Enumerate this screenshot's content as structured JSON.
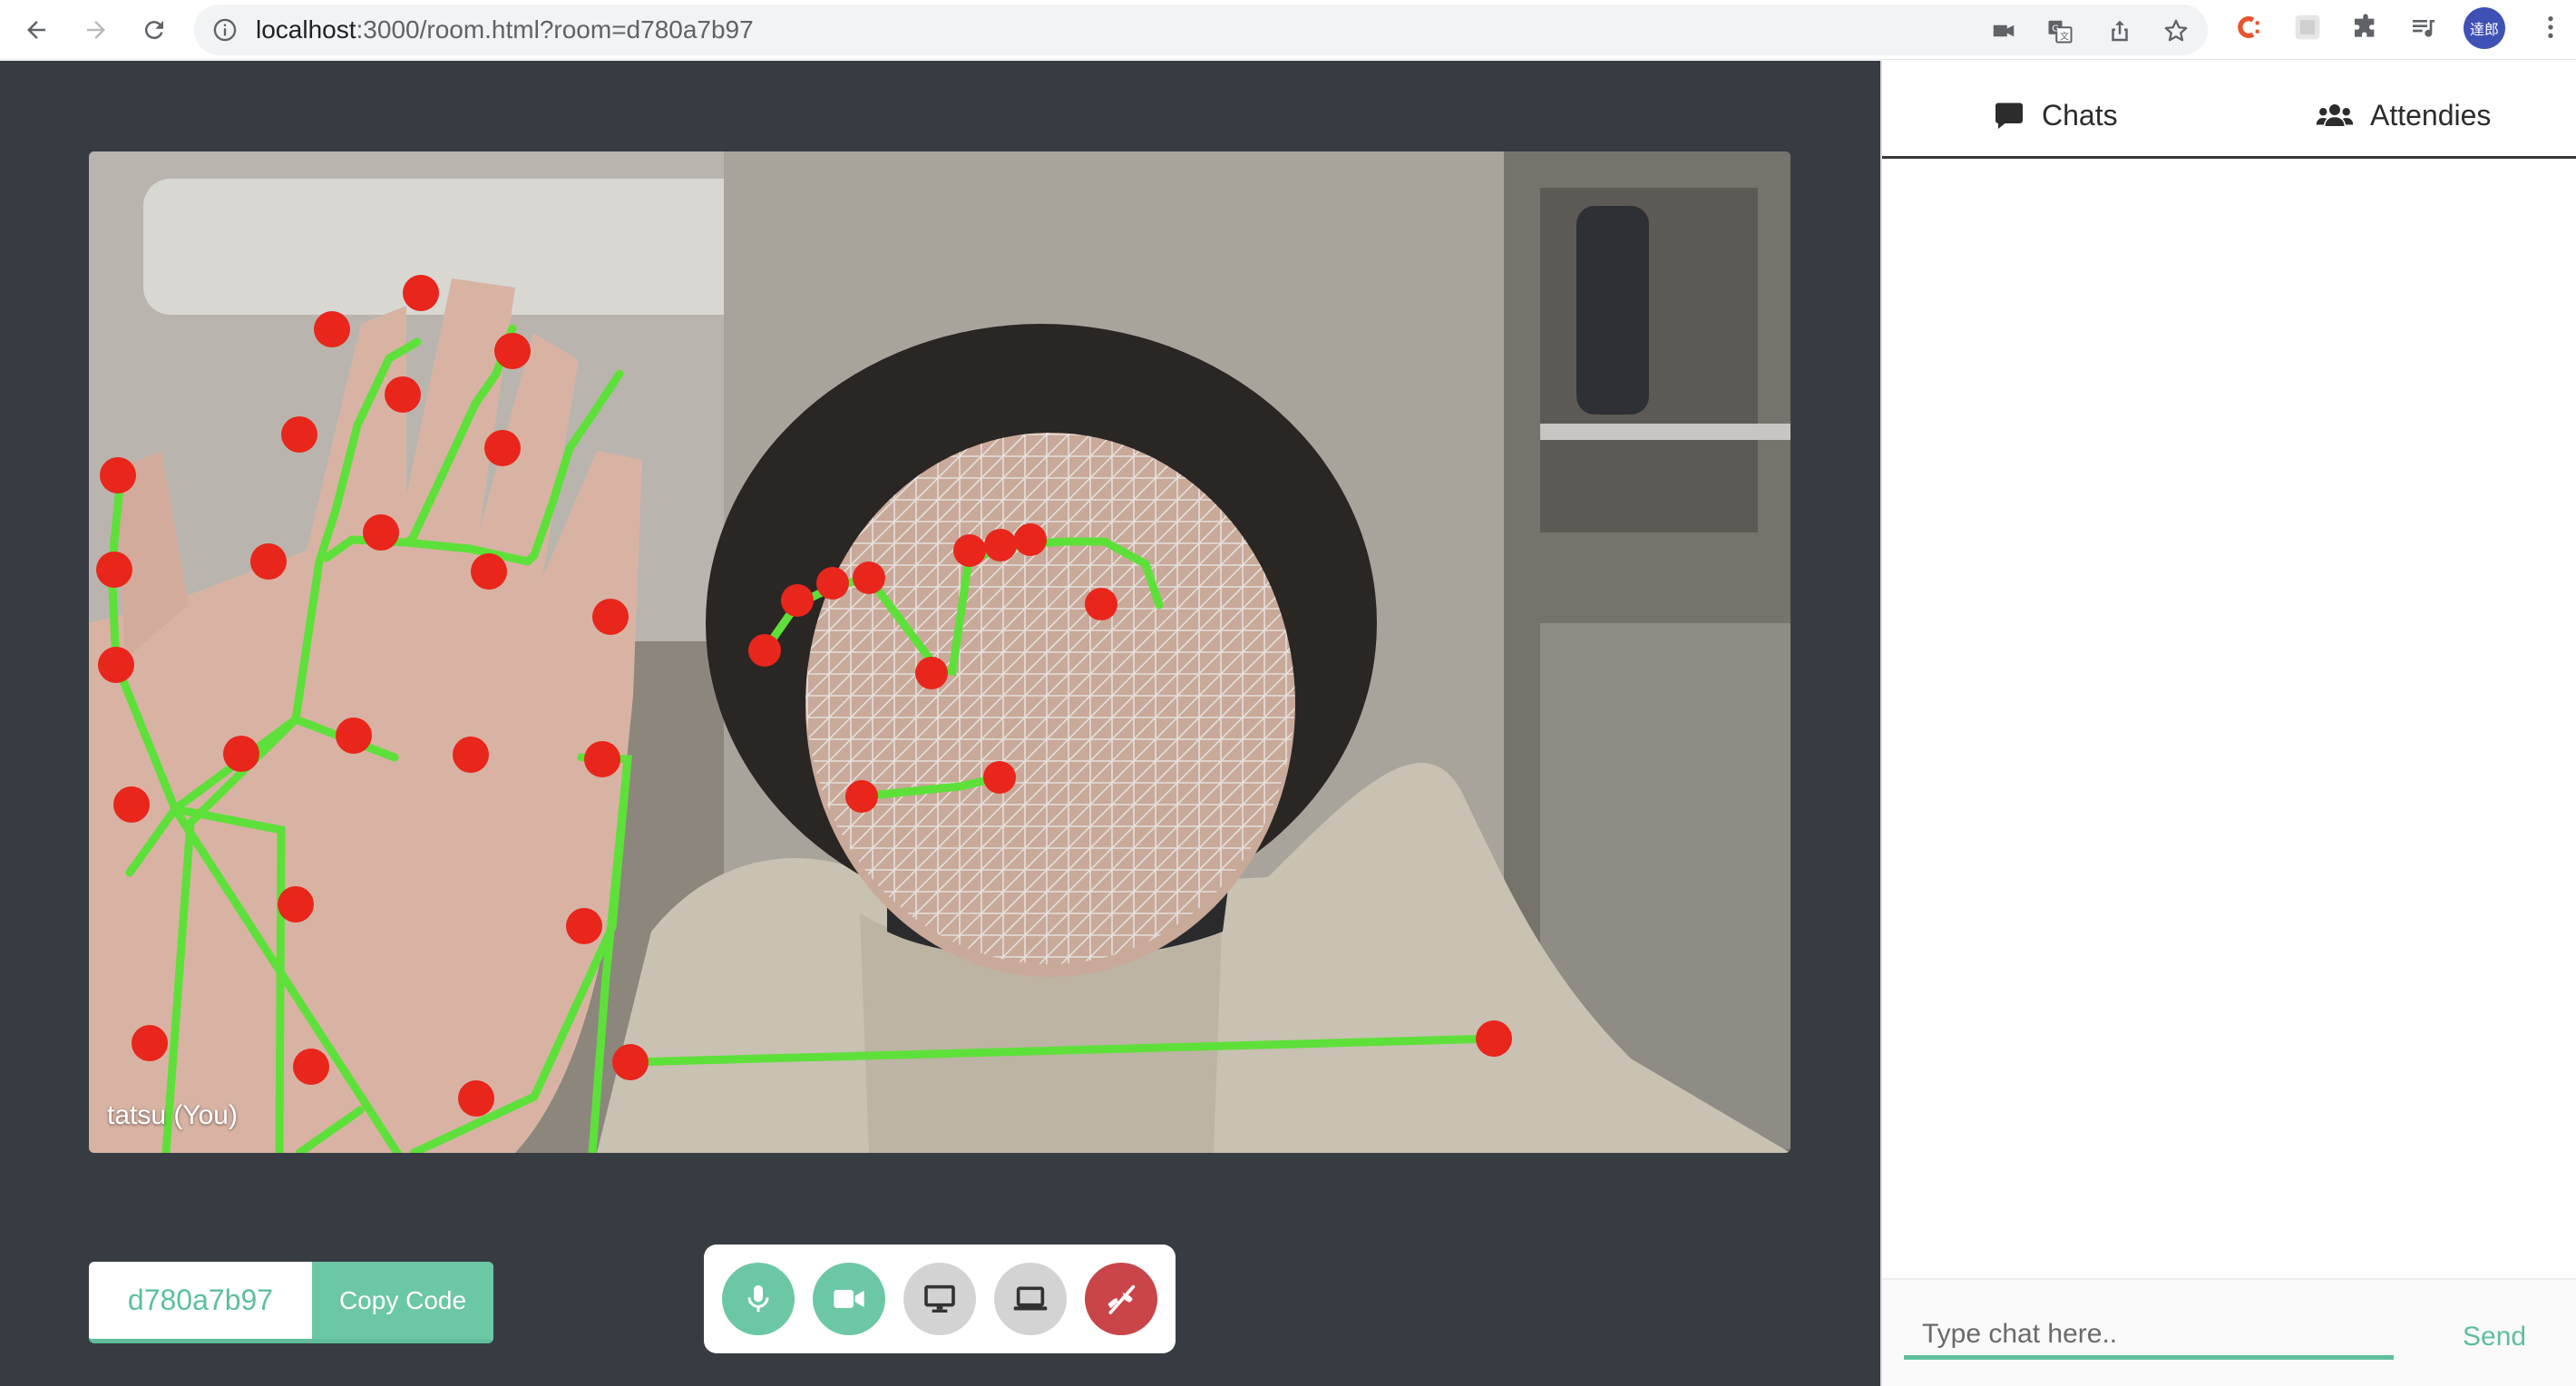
{
  "browser": {
    "url_host": "localhost",
    "url_path": ":3000/room.html?room=d780a7b97",
    "avatar_text": "達郎",
    "icons": [
      "back-icon",
      "forward-icon",
      "reload-icon",
      "info-icon",
      "camera-icon",
      "translate-icon",
      "share-icon",
      "star-icon",
      "extension-c-icon",
      "extension-grid-icon",
      "puzzle-icon",
      "playlist-icon",
      "more-vert-icon"
    ]
  },
  "video": {
    "participant_name": "tatsu (You)"
  },
  "room": {
    "code": "d780a7b97",
    "copy_label": "Copy Code"
  },
  "controls": {
    "buttons": [
      "mic-button",
      "camera-button",
      "screen-share-button",
      "laptop-button",
      "end-call-button"
    ],
    "colors": {
      "active": "#6cc7a5",
      "inactive": "#d3d3d3",
      "end": "#c9454a"
    }
  },
  "side_panel": {
    "tabs": [
      {
        "label": "Chats",
        "icon": "chat-bubble-icon"
      },
      {
        "label": "Attendies",
        "icon": "users-icon"
      }
    ],
    "chat_placeholder": "Type chat here..",
    "send_label": "Send"
  },
  "colors": {
    "accent": "#5fbf9b",
    "background": "#373c43",
    "landmark": "#e8261c",
    "skeleton": "#5ee03a"
  }
}
